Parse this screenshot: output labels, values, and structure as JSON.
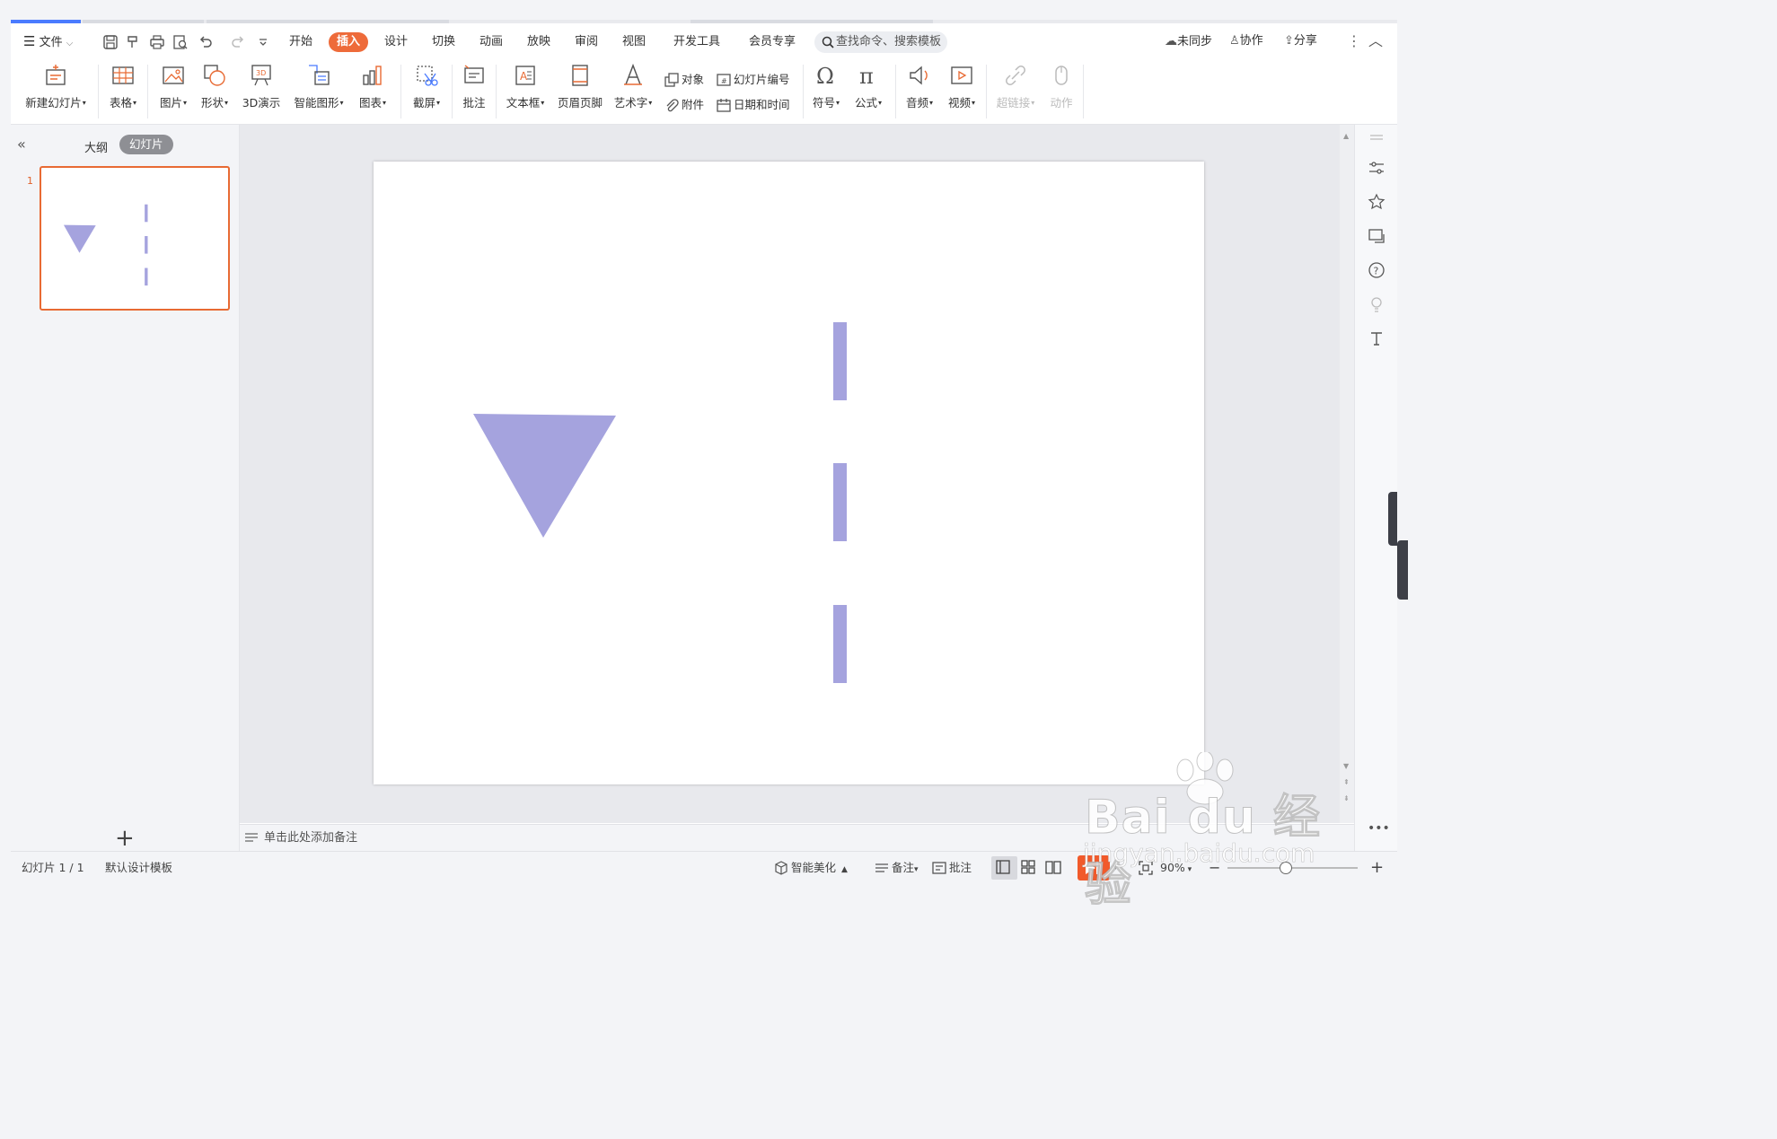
{
  "menubar": {
    "file_label": "文件",
    "tabs": [
      "开始",
      "插入",
      "设计",
      "切换",
      "动画",
      "放映",
      "审阅",
      "视图",
      "开发工具",
      "会员专享"
    ],
    "active_tab": "插入",
    "search_placeholder": "查找命令、搜索模板",
    "sync_label": "未同步",
    "collab_label": "协作",
    "share_label": "分享"
  },
  "ribbon": {
    "new_slide": "新建幻灯片",
    "table": "表格",
    "picture": "图片",
    "shape": "形状",
    "demo3d": "3D演示",
    "smartart": "智能图形",
    "chart": "图表",
    "screenshot": "截屏",
    "comment": "批注",
    "textbox": "文本框",
    "header_footer": "页眉页脚",
    "wordart": "艺术字",
    "object": "对象",
    "attachment": "附件",
    "slide_number": "幻灯片编号",
    "datetime": "日期和时间",
    "symbol": "符号",
    "formula": "公式",
    "audio": "音频",
    "video": "视频",
    "hyperlink": "超链接",
    "action": "动作"
  },
  "left_panel": {
    "outline_tab": "大纲",
    "slides_tab": "幻灯片",
    "slide_number": "1"
  },
  "slide": {
    "shape_color": "#a5a3de"
  },
  "notes": {
    "placeholder": "单击此处添加备注"
  },
  "status": {
    "slide_counter": "幻灯片 1 / 1",
    "template": "默认设计模板",
    "beautify": "智能美化",
    "notes": "备注",
    "comment": "批注",
    "zoom": "90%"
  },
  "watermark": {
    "brand": "Bai du 经验",
    "url": "jingyan.baidu.com"
  },
  "colors": {
    "accent": "#ee6b3a",
    "shape": "#a5a3de",
    "tab_highlight": "#4a7bff"
  }
}
